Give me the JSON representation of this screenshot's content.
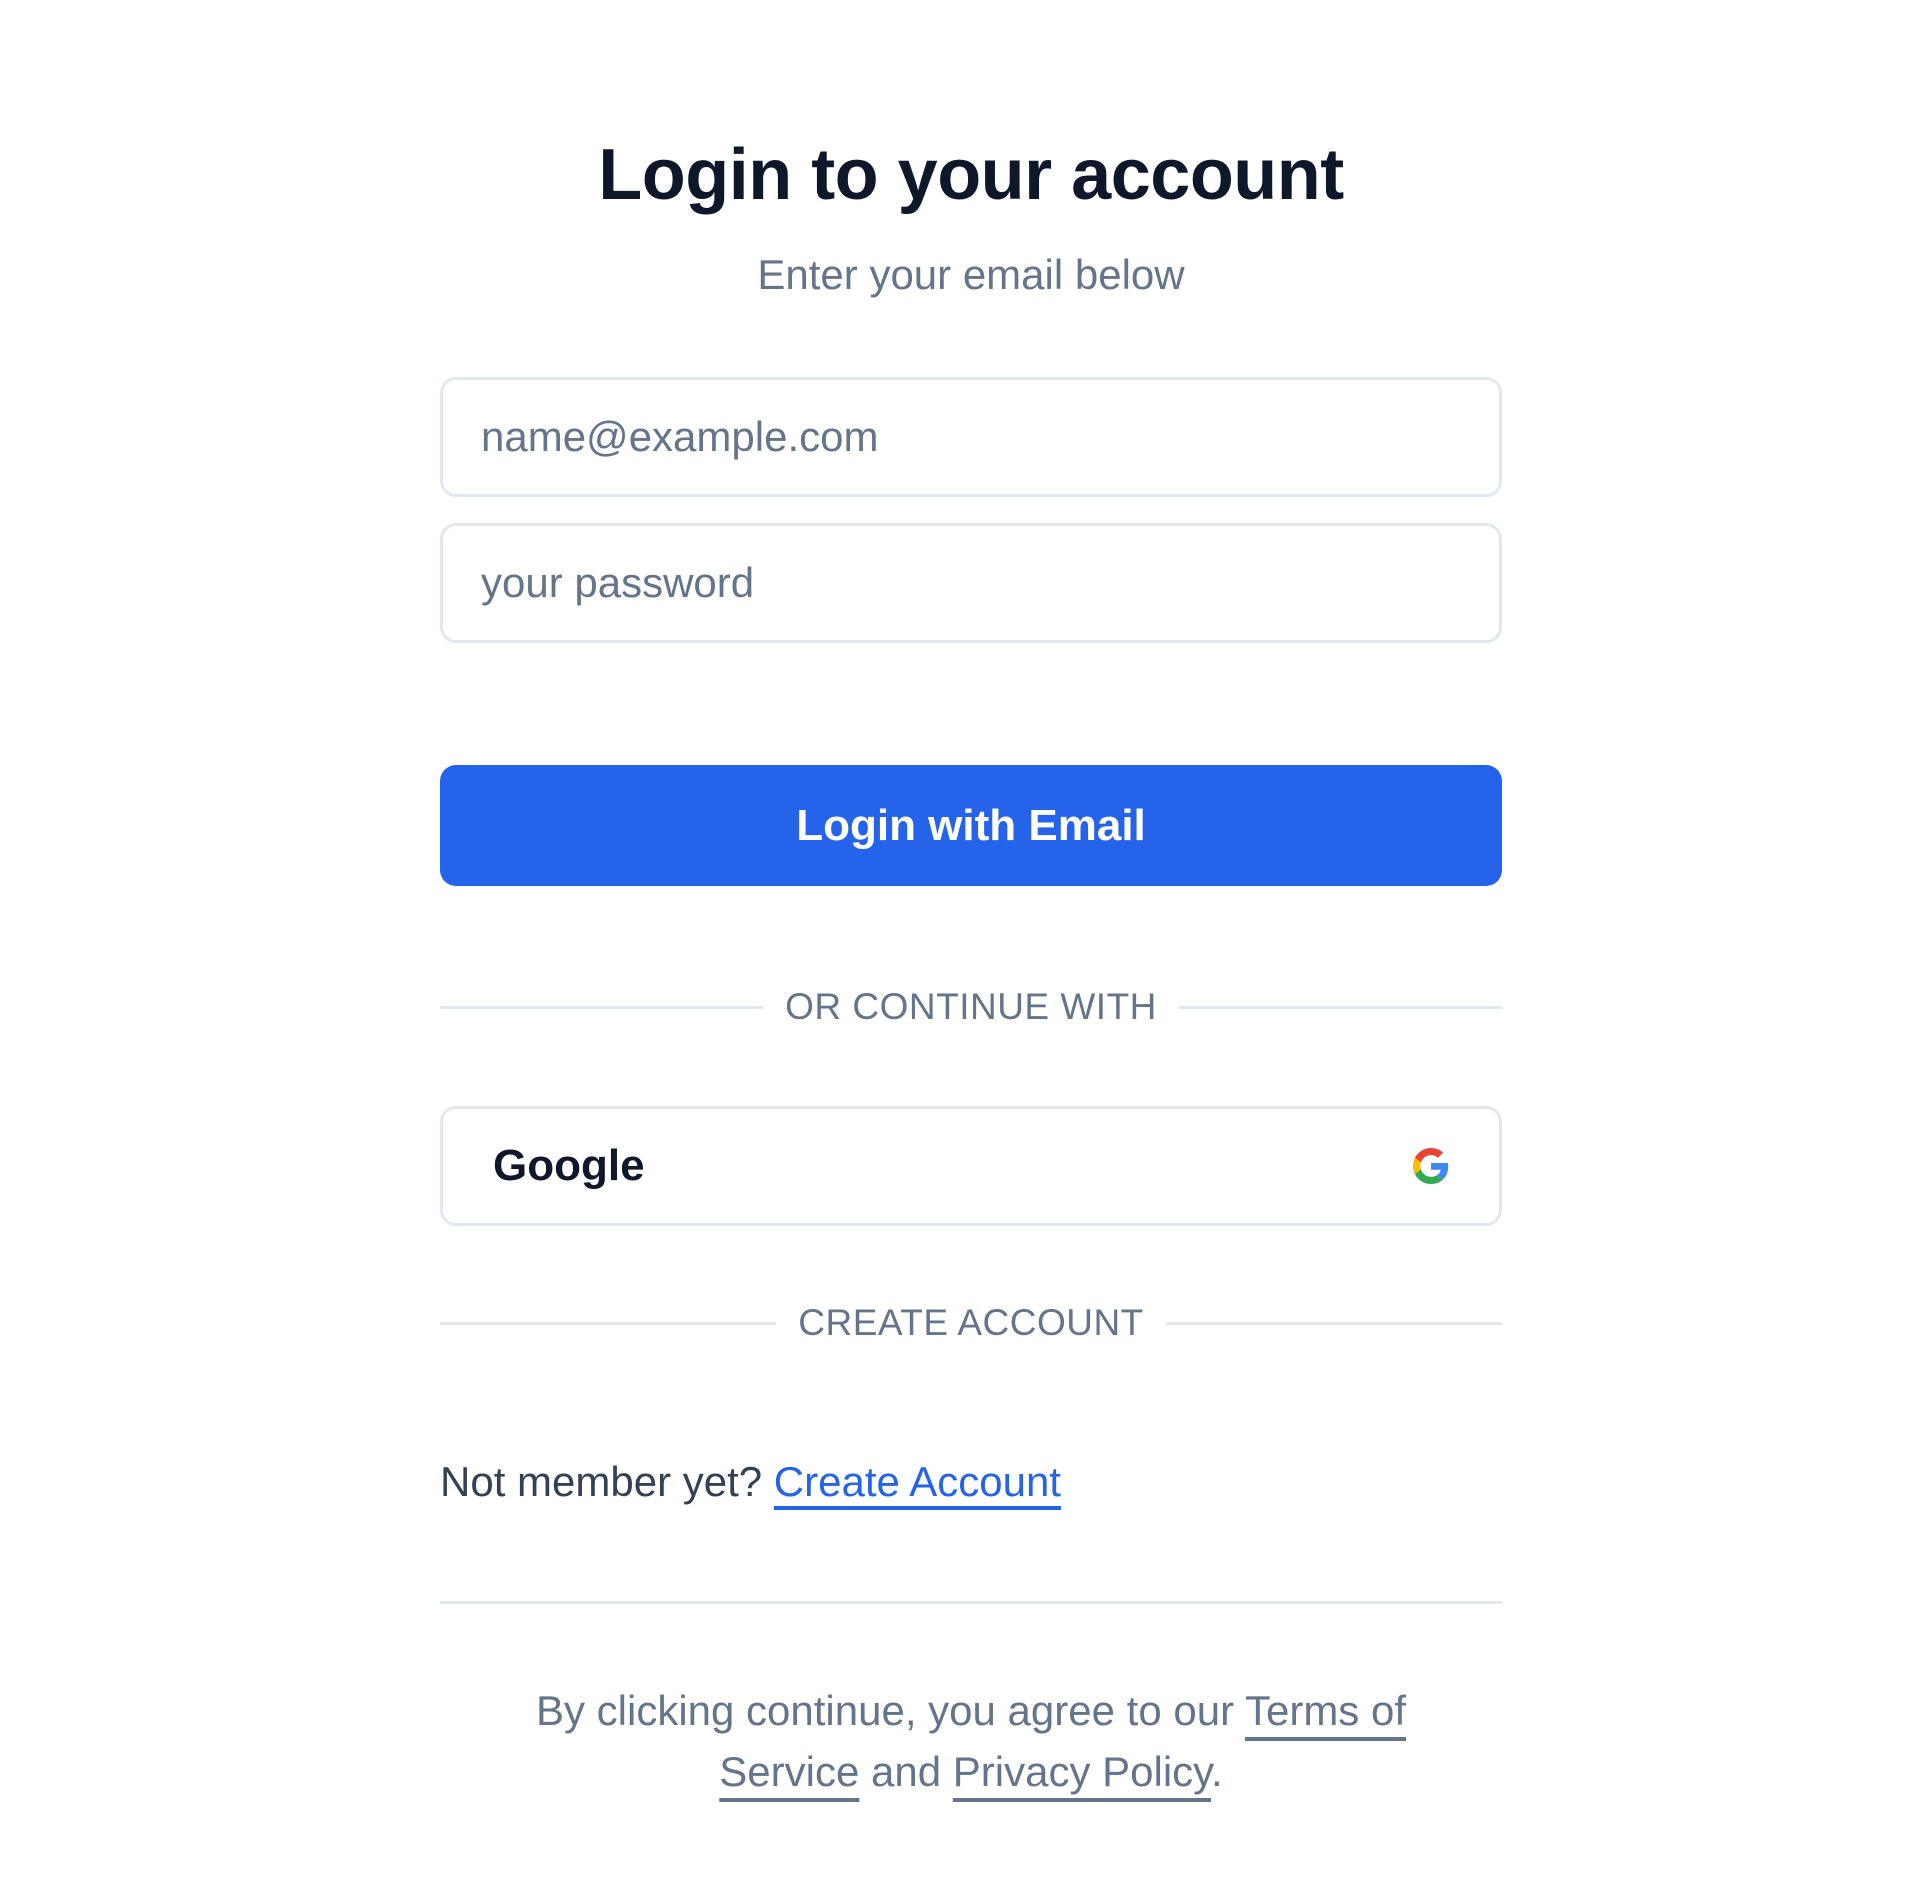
{
  "header": {
    "title": "Login to your account",
    "subtitle": "Enter your email below"
  },
  "form": {
    "email_placeholder": "name@example.com",
    "email_value": "",
    "password_placeholder": "your password",
    "password_value": "",
    "submit_label": "Login with Email"
  },
  "divider_or": {
    "label": "OR CONTINUE WITH"
  },
  "oauth": {
    "google_label": "Google",
    "google_icon": "google-icon"
  },
  "divider_create": {
    "label": "CREATE ACCOUNT"
  },
  "signup": {
    "prompt": "Not member yet? ",
    "link_label": "Create Account"
  },
  "legal": {
    "prefix": "By clicking continue, you agree to our ",
    "terms_label": "Terms of Service",
    "middle": " and ",
    "privacy_label": "Privacy Policy",
    "suffix": "."
  },
  "colors": {
    "primary": "#2563eb",
    "text": "#0f172a",
    "muted": "#64748b",
    "border": "#e2e8f0"
  }
}
